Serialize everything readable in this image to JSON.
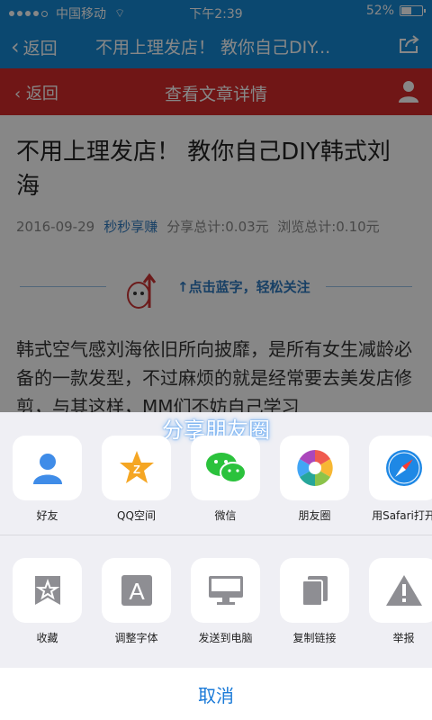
{
  "status_bar": {
    "carrier": "中国移动",
    "time": "下午2:39",
    "battery": "52%",
    "battery_level": 0.52
  },
  "nav": {
    "back_label": "返回",
    "title": "不用上理发店！ 教你自己DIY..."
  },
  "web_header": {
    "back_label": "返回",
    "title": "查看文章详情"
  },
  "article": {
    "title": "不用上理发店！ 教你自己DIY韩式刘海",
    "date": "2016-09-29",
    "author": "秒秒享赚",
    "share_total": "分享总计:0.03元",
    "view_total": "浏览总计:0.10元",
    "follow_text": "点击蓝字，轻松关注",
    "paragraph": "韩式空气感刘海依旧所向披靡，是所有女生减龄必备的一款发型，不过麻烦的就是经常要去美发店修剪，与其这样，MM们不妨自己学习"
  },
  "share_sheet": {
    "caption": "分享朋友圈",
    "row1": [
      {
        "label": "好友",
        "icon": "qq-friend-icon",
        "color": "#3f8ce8"
      },
      {
        "label": "QQ空间",
        "icon": "qzone-star-icon",
        "color": "#f5a623"
      },
      {
        "label": "微信",
        "icon": "wechat-icon",
        "color": "#2bc23c"
      },
      {
        "label": "朋友圈",
        "icon": "moments-shutter-icon",
        "color": "#e85e5e"
      },
      {
        "label": "用Safari打开",
        "icon": "safari-compass-icon",
        "color": "#1e88e5"
      }
    ],
    "row2": [
      {
        "label": "收藏",
        "icon": "bookmark-star-icon"
      },
      {
        "label": "调整字体",
        "icon": "font-a-icon"
      },
      {
        "label": "发送到电脑",
        "icon": "monitor-icon"
      },
      {
        "label": "复制链接",
        "icon": "copy-icon"
      },
      {
        "label": "举报",
        "icon": "warning-icon"
      }
    ],
    "cancel_label": "取消"
  }
}
